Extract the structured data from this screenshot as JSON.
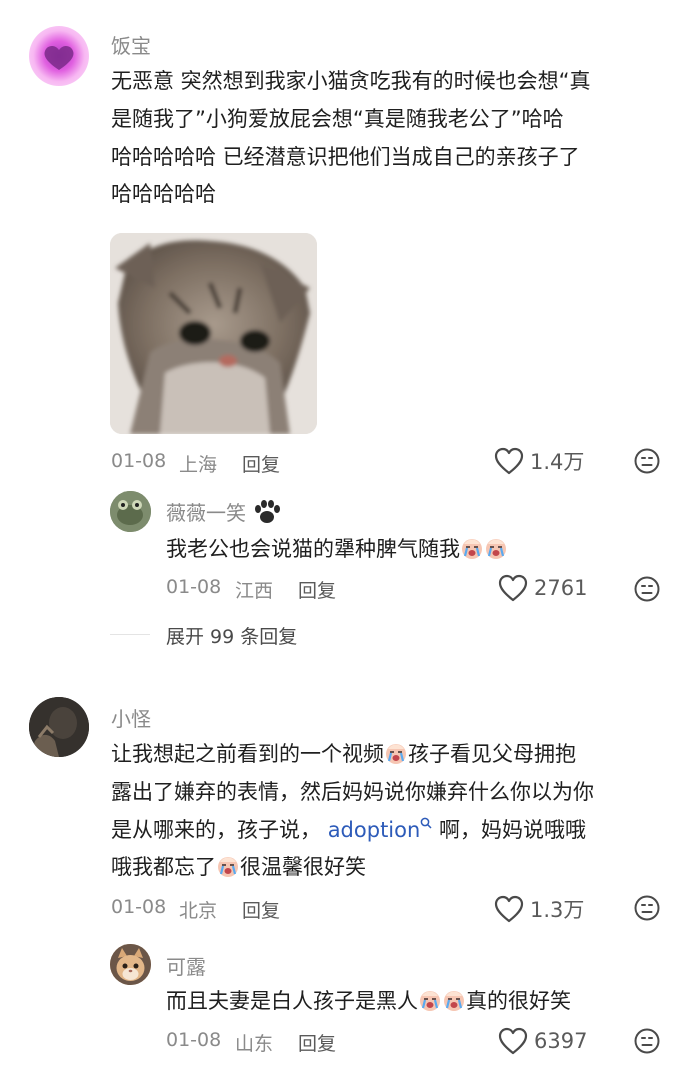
{
  "comments": [
    {
      "user": "饭宝",
      "text_lines": [
        "无恶意  突然想到我家小猫贪吃我有的时候也会想“真",
        "是随我了”小狗爱放屁会想“真是随我老公了”哈哈",
        "哈哈哈哈哈 已经潜意识把他们当成自己的亲孩子了",
        "哈哈哈哈哈"
      ],
      "date": "01-08",
      "location": "上海",
      "reply_label": "回复",
      "likes": "1.4万",
      "replies": [
        {
          "user": "薇薇一笑",
          "text": "我老公也会说猫的犟种脾气随我",
          "date": "01-08",
          "location": "江西",
          "reply_label": "回复",
          "likes": "2761"
        }
      ],
      "expand_label": "展开 99 条回复"
    },
    {
      "user": "小怪",
      "text_lines": [
        "让我想起之前看到的一个视频",
        "孩子看见父母拥抱",
        "露出了嫌弃的表情，然后妈妈说你嫌弃什么你以为你",
        "是从哪来的，孩子说，",
        "adoption",
        "啊，妈妈说哦哦",
        "哦我都忘了",
        "很温馨很好笑"
      ],
      "date": "01-08",
      "location": "北京",
      "reply_label": "回复",
      "likes": "1.3万",
      "replies": [
        {
          "user": "可露",
          "text": "而且夫妻是白人孩子是黑人",
          "text_suffix": "真的很好笑",
          "date": "01-08",
          "location": "山东",
          "reply_label": "回复",
          "likes": "6397"
        }
      ]
    }
  ],
  "colors": {
    "muted": "#8a8a8a",
    "link": "#2d5bb9",
    "heart_stroke": "#4a4a4a"
  },
  "icons": [
    "heart-outline-icon",
    "dislike-face-icon",
    "paw-icon",
    "crying-emoji-icon",
    "search-icon"
  ]
}
